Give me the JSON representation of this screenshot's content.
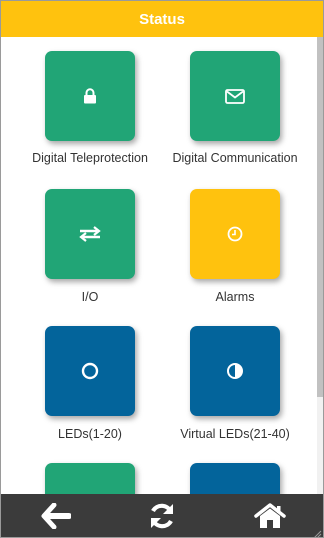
{
  "header": {
    "title": "Status"
  },
  "tiles": [
    {
      "label": "Digital Teleprotection",
      "icon": "lock-icon",
      "color": "#21a576"
    },
    {
      "label": "Digital Communication",
      "icon": "envelope-icon",
      "color": "#21a576"
    },
    {
      "label": "I/O",
      "icon": "swap-arrows-icon",
      "color": "#21a576"
    },
    {
      "label": "Alarms",
      "icon": "clock-icon",
      "color": "#ffc20e"
    },
    {
      "label": "LEDs(1-20)",
      "icon": "circle-outline-icon",
      "color": "#03649b"
    },
    {
      "label": "Virtual LEDs(21-40)",
      "icon": "half-circle-icon",
      "color": "#03649b"
    }
  ],
  "bottom_nav": [
    {
      "icon": "back-arrow-icon"
    },
    {
      "icon": "refresh-icon"
    },
    {
      "icon": "home-icon"
    }
  ],
  "colors": {
    "accent": "#ffc20e",
    "green": "#21a576",
    "blue": "#03649b",
    "bar": "#3b3b3b"
  }
}
